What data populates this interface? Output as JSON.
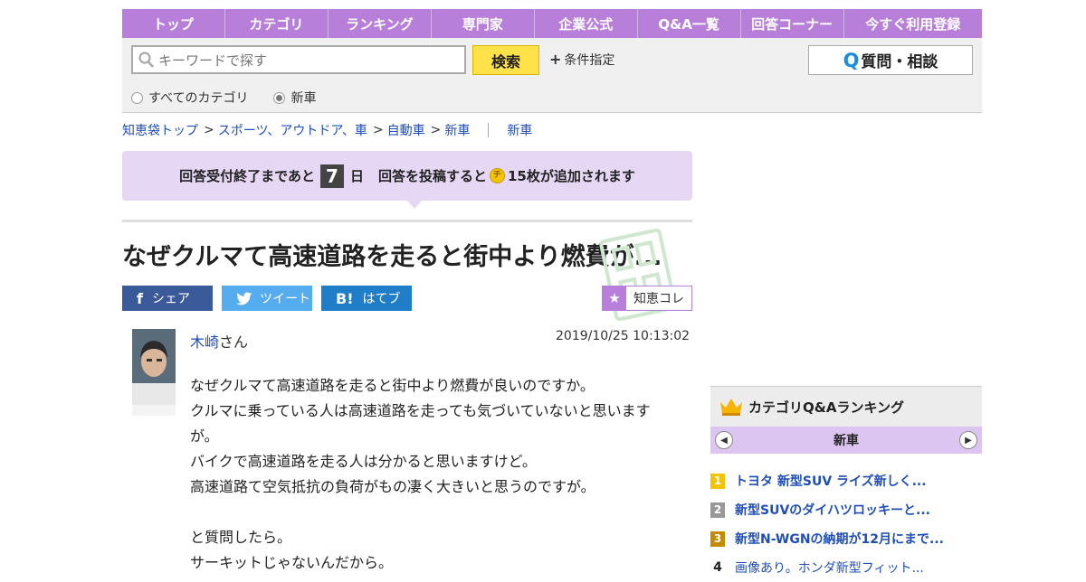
{
  "nav": {
    "items": [
      "トップ",
      "カテゴリ",
      "ランキング",
      "専門家",
      "企業公式",
      "Q&A一覧",
      "回答コーナー",
      "今すぐ利用登録"
    ]
  },
  "search": {
    "placeholder": "キーワードで探す",
    "button_label": "検索",
    "condition_label": "条件指定",
    "ask_button_label": "質問・相談",
    "ask_button_q": "Q",
    "scopes": [
      {
        "label": "すべてのカテゴリ",
        "selected": false
      },
      {
        "label": "新車",
        "selected": true
      }
    ]
  },
  "breadcrumb": {
    "items": [
      "知恵袋トップ",
      "スポーツ、アウトドア、車",
      "自動車",
      "新車"
    ],
    "current": "新車",
    "separator": ">"
  },
  "notice": {
    "prefix": "回答受付終了まであと",
    "days": "7",
    "days_unit": "日",
    "middle": "回答を投稿すると",
    "coin_glyph": "チ",
    "suffix": "15枚が追加されます"
  },
  "question": {
    "title": "なぜクルマて高速道路を走ると街中より燃費が...",
    "user_name": "木崎",
    "user_suffix": "さん",
    "datetime": "2019/10/25  10:13:02",
    "body_lines": [
      "なぜクルマて高速道路を走ると街中より燃費が良いのですか。",
      "クルマに乗っている人は高速道路を走っても気づいていないと思います",
      "が。",
      "バイクで高速道路を走る人は分かると思いますけど。",
      "高速道路て空気抵抗の負荷がもの凄く大きいと思うのですが。",
      "",
      "と質問したら。",
      "サーキットじゃないんだから。"
    ]
  },
  "share": {
    "facebook_label": "シェア",
    "facebook_icon": "f",
    "twitter_label": "ツイート",
    "hatena_label": "はてブ",
    "hatena_icon": "B!",
    "chiekore_label": "知恵コレ",
    "chiekore_icon": "★"
  },
  "ranking": {
    "heading": "カテゴリQ&Aランキング",
    "category": "新車",
    "items": [
      {
        "rank": "1",
        "title": "トヨタ 新型SUV ライズ新しく..."
      },
      {
        "rank": "2",
        "title": "新型SUVのダイハツロッキーと..."
      },
      {
        "rank": "3",
        "title": "新型N-WGNの納期が12月にまで..."
      },
      {
        "rank": "4",
        "title": "画像あり。ホンダ新型フィット..."
      }
    ]
  },
  "colors": {
    "nav": "#b77fd9",
    "search_button": "#ffe14a",
    "notice_bg": "#e6d7f5",
    "link": "#1f4eb8",
    "facebook": "#3b5a9a",
    "twitter": "#55acee",
    "hatena": "#1f7ec7"
  }
}
